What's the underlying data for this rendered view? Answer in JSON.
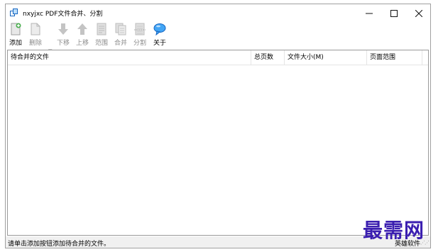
{
  "window": {
    "title": "nxyjxc PDF文件合并、分割"
  },
  "toolbar": {
    "add": "添加",
    "delete": "删除",
    "move_down": "下移",
    "move_up": "上移",
    "range": "范围",
    "merge": "合并",
    "split": "分割",
    "about": "关于"
  },
  "list": {
    "columns": [
      "待合并的文件",
      "总页数",
      "文件大小(M)",
      "页面范围"
    ],
    "rows": []
  },
  "status": {
    "message": "请单击添加按钮添加待合并的文件。",
    "right_text": "英雄软件"
  },
  "watermark": "最需网",
  "colors": {
    "accent_blue": "#1e88e5",
    "watermark": "#3b1fb0"
  }
}
